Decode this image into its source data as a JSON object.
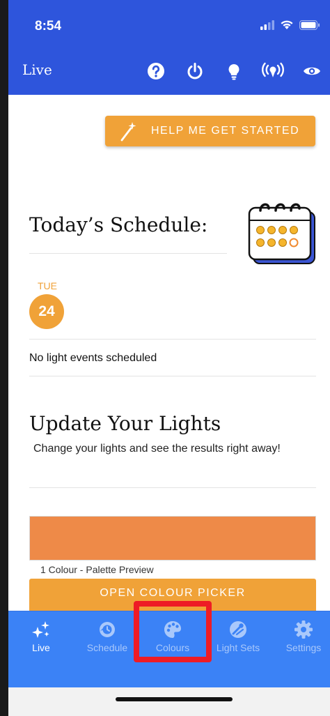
{
  "status_bar": {
    "time": "8:54"
  },
  "app_bar": {
    "title": "Live",
    "actions": [
      "help-icon",
      "power-icon",
      "bulb-icon",
      "broadcast-icon",
      "eye-icon"
    ]
  },
  "help_button": {
    "label": "HELP ME GET STARTED"
  },
  "schedule": {
    "title": "Today’s Schedule:",
    "day_name": "TUE",
    "day_number": "24",
    "empty_text": "No light events scheduled"
  },
  "update": {
    "title": "Update Your Lights",
    "description": "Change your lights and see the results right away!"
  },
  "palette": {
    "preview_color": "#ee8a48",
    "caption": "1 Colour - Palette Preview",
    "button_label": "OPEN COLOUR PICKER"
  },
  "tabs": [
    {
      "label": "Live",
      "icon": "sparkles-icon",
      "active": true
    },
    {
      "label": "Schedule",
      "icon": "clock-icon",
      "active": false
    },
    {
      "label": "Colours",
      "icon": "palette-icon",
      "active": false
    },
    {
      "label": "Light Sets",
      "icon": "light-sets-icon",
      "active": false
    },
    {
      "label": "Settings",
      "icon": "gear-icon",
      "active": false
    }
  ],
  "colors": {
    "primary_blue": "#2e55dc",
    "tab_blue": "#3b82f6",
    "accent_orange": "#f0a238",
    "highlight_red": "#ee1c25"
  }
}
